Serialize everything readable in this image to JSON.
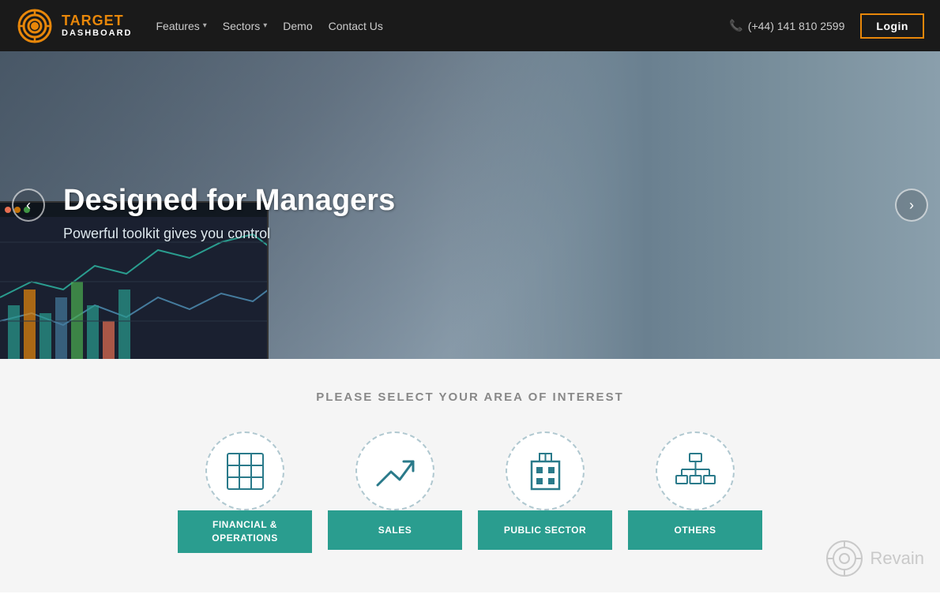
{
  "navbar": {
    "logo": {
      "target_text": "TARGET",
      "dashboard_text": "DASHBOARD"
    },
    "nav_items": [
      {
        "label": "Features",
        "has_dropdown": true
      },
      {
        "label": "Sectors",
        "has_dropdown": true
      },
      {
        "label": "Demo",
        "has_dropdown": false
      },
      {
        "label": "Contact Us",
        "has_dropdown": false
      }
    ],
    "phone": "(+44) 141 810 2599",
    "login_label": "Login"
  },
  "hero": {
    "title": "Designed for Managers",
    "subtitle": "Powerful toolkit gives you control",
    "prev_arrow": "‹",
    "next_arrow": "›"
  },
  "interest_section": {
    "title": "PLEASE SELECT YOUR AREA OF INTEREST",
    "cards": [
      {
        "label": "FINANCIAL &\nOPERATIONS",
        "icon": "▦"
      },
      {
        "label": "SALES",
        "icon": "↗"
      },
      {
        "label": "PUBLIC SECTOR",
        "icon": "⊞"
      },
      {
        "label": "OTHERS",
        "icon": "⊙"
      }
    ]
  },
  "watermark": {
    "text": "Revain"
  }
}
